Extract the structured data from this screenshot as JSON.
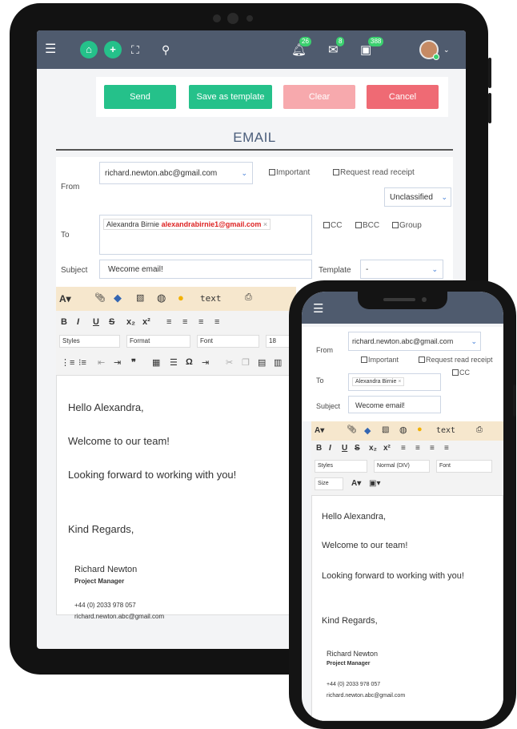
{
  "header": {
    "notifications_count": "26",
    "messages_count": "8",
    "tasks_count": "388"
  },
  "actions": {
    "send": "Send",
    "save_template": "Save as template",
    "clear": "Clear",
    "cancel": "Cancel"
  },
  "colors": {
    "topbar": "#4f5b6e",
    "send": "#25c18a",
    "clear": "#f7a9ad",
    "cancel": "#ef6a74",
    "toolbar": "#f6e7cd"
  },
  "page_title": "EMAIL",
  "form": {
    "from_label": "From",
    "from_value": "richard.newton.abc@gmail.com",
    "important_label": "Important",
    "read_receipt_label": "Request read receipt",
    "classification": "Unclassified",
    "to_label": "To",
    "to_recipient_name": "Alexandra Birnie",
    "to_recipient_email": "alexandrabirnie1@gmail.com",
    "cc_label": "CC",
    "bcc_label": "BCC",
    "group_label": "Group",
    "subject_label": "Subject",
    "subject_value": "Wecome email!",
    "template_label": "Template",
    "template_value": "-"
  },
  "editor": {
    "text_button": "text",
    "styles_placeholder": "Styles",
    "format_placeholder": "Format",
    "font_placeholder": "Font",
    "size_value": "18",
    "normal_div": "Normal (DIV)",
    "size_placeholder": "Size"
  },
  "message": {
    "greeting": "Hello Alexandra,",
    "line1": "Welcome to our team!",
    "line2": "Looking forward to working with you!",
    "closing": "Kind Regards,",
    "sig_name": "Richard Newton",
    "sig_title": "Project Manager",
    "sig_phone": "+44 (0) 2033 978 057",
    "sig_email": "richard.newton.abc@gmail.com"
  },
  "icons": [
    "menu-icon",
    "home-icon",
    "plus-icon",
    "fullscreen-icon",
    "search-icon",
    "bell-icon",
    "mail-icon",
    "calendar-icon",
    "chevron-down-icon"
  ]
}
